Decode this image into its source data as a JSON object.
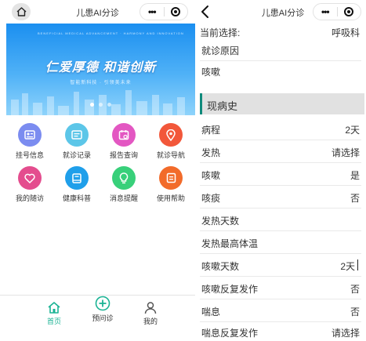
{
  "left": {
    "title": "儿患AI分诊",
    "banner": {
      "ribbon": "BENEFICIAL MEDICAL ADVANCEMENT · HARMONY AND INNOVATION",
      "slogan": "仁爱厚德 和谐创新",
      "subtitle": "智能新科技 · 引领美未来",
      "slides": 3,
      "active_slide": 1
    },
    "menu": [
      {
        "label": "挂号信息",
        "icon": "id-card-icon",
        "color": "#7b8cf0"
      },
      {
        "label": "就诊记录",
        "icon": "record-icon",
        "color": "#5cc6e8"
      },
      {
        "label": "报告查询",
        "icon": "calendar-icon",
        "color": "#e357c2"
      },
      {
        "label": "就诊导航",
        "icon": "location-icon",
        "color": "#f2573a"
      },
      {
        "label": "我的随访",
        "icon": "heart-icon",
        "color": "#e44d8e"
      },
      {
        "label": "健康科普",
        "icon": "book-icon",
        "color": "#1f9fea"
      },
      {
        "label": "消息提醒",
        "icon": "lightbulb-icon",
        "color": "#38d07a"
      },
      {
        "label": "使用帮助",
        "icon": "help-icon",
        "color": "#f26b2a"
      }
    ],
    "tabs": [
      {
        "label": "首页",
        "icon": "home-icon",
        "active": true
      },
      {
        "label": "预问诊",
        "icon": "plus-circle-icon",
        "active": false
      },
      {
        "label": "我的",
        "icon": "user-icon",
        "active": false
      }
    ]
  },
  "right": {
    "title": "儿患AI分诊",
    "current_label": "当前选择:",
    "current_value": "呼吸科",
    "visit_reason_label": "就诊原因",
    "visit_reason_value": "咳嗽",
    "section_title": "现病史",
    "rows": [
      {
        "label": "病程",
        "value": "2天"
      },
      {
        "label": "发热",
        "value": "请选择"
      },
      {
        "label": "咳嗽",
        "value": "是"
      },
      {
        "label": "咳痰",
        "value": "否"
      },
      {
        "label": "发热天数",
        "value": ""
      },
      {
        "label": "发热最高体温",
        "value": ""
      },
      {
        "label": "咳嗽天数",
        "value": "2天"
      },
      {
        "label": "咳嗽反复发作",
        "value": "否"
      },
      {
        "label": "喘息",
        "value": "否"
      },
      {
        "label": "喘息反复发作",
        "value": "请选择"
      }
    ]
  },
  "colors": {
    "accent": "#1ab394",
    "section_bar": "#0f8a7c",
    "banner_top": "#1b8ff0"
  }
}
